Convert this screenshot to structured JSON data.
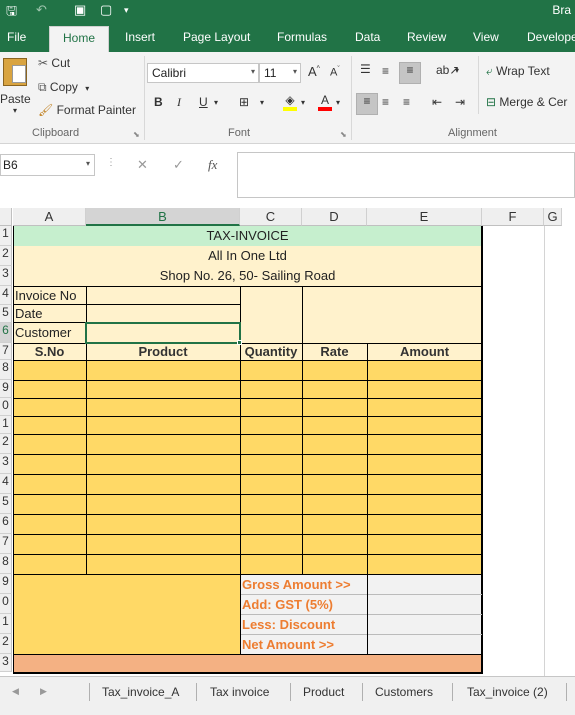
{
  "title_bar": {
    "app_name": "Bra"
  },
  "ribbon_tabs": [
    "File",
    "Home",
    "Insert",
    "Page Layout",
    "Formulas",
    "Data",
    "Review",
    "View",
    "Develope"
  ],
  "active_tab": "Home",
  "clipboard": {
    "paste": "Paste",
    "cut": "Cut",
    "copy": "Copy",
    "format_painter": "Format Painter",
    "label": "Clipboard"
  },
  "font": {
    "name": "Calibri",
    "size": "11",
    "bold": "B",
    "italic": "I",
    "underline": "U",
    "font_color_letter": "A",
    "grow": "A",
    "shrink": "A",
    "label": "Font"
  },
  "alignment": {
    "wrap_text": "Wrap Text",
    "merge": "Merge & Cer",
    "label": "Alignment"
  },
  "formula_bar": {
    "name_box": "B6",
    "fx": "fx",
    "cancel": "✕",
    "enter": "✓",
    "content": ""
  },
  "columns": [
    "A",
    "B",
    "C",
    "D",
    "E",
    "F",
    "G"
  ],
  "selected_column": "B",
  "rows": [
    "1",
    "2",
    "3",
    "4",
    "5",
    "6",
    "7",
    "8",
    "9",
    "0",
    "1",
    "2",
    "3",
    "4",
    "5",
    "6",
    "7",
    "8",
    "9",
    "0",
    "1",
    "2",
    "3"
  ],
  "invoice": {
    "heading": "TAX-INVOICE",
    "company": "All In One Ltd",
    "address": "Shop No. 26, 50- Sailing Road",
    "labels": [
      "Invoice No",
      "Date",
      "Customer"
    ],
    "headers": [
      "S.No",
      "Product",
      "Quantity",
      "Rate",
      "Amount"
    ],
    "totals": [
      "Gross Amount >>",
      "Add: GST (5%)",
      "Less: Discount",
      "Net Amount >>"
    ]
  },
  "sheet_tabs": [
    "Tax_invoice_A",
    "Tax invoice",
    "Product",
    "Customers",
    "Tax_invoice (2)"
  ],
  "colors": {
    "excel_green": "#217346",
    "header_green": "#c6efce",
    "light_yellow": "#fff2cc",
    "yellow": "#ffd966",
    "salmon": "#f4b183",
    "orange_text": "#ed7d31"
  }
}
